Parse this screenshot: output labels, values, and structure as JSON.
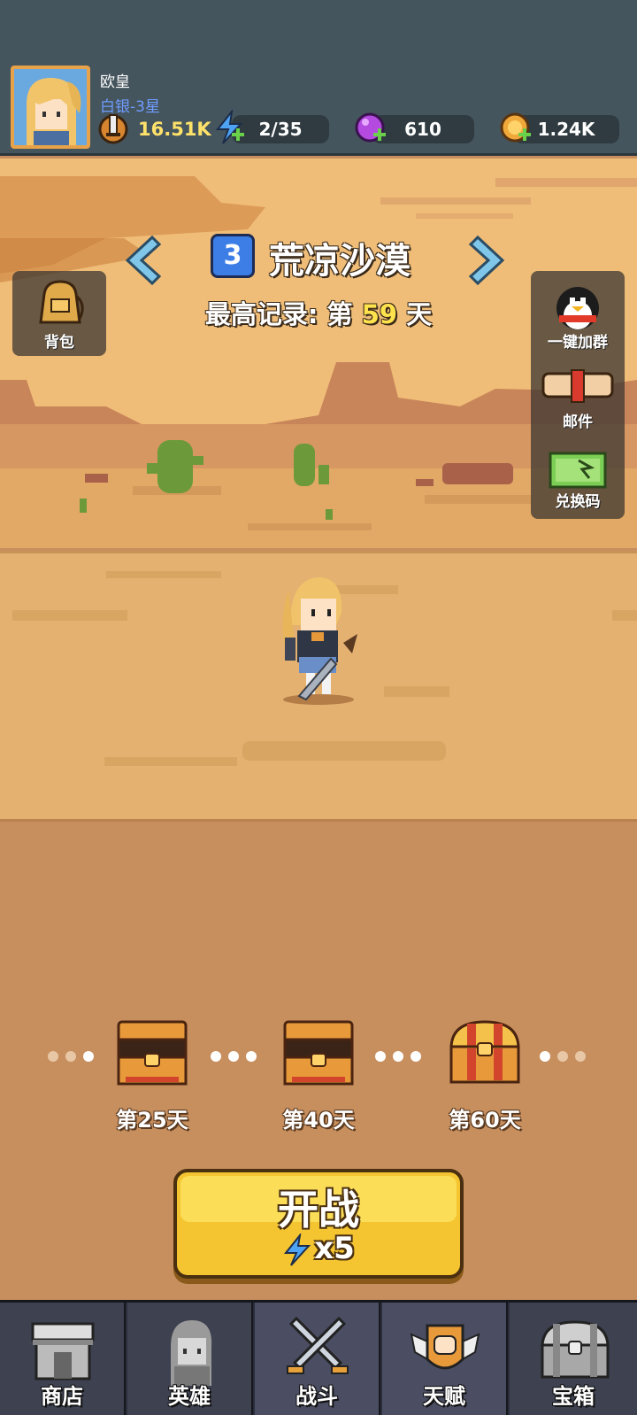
{
  "player": {
    "name": "欧皇",
    "rank": "白银-3星",
    "power": "16.51K"
  },
  "resources": {
    "energy": "2/35",
    "gems": "610",
    "gold": "1.24K"
  },
  "stage": {
    "number": "3",
    "name": "荒凉沙漠",
    "record_prefix": "最高记录: 第",
    "record_day": "59",
    "record_suffix": "天"
  },
  "side_buttons": {
    "backpack": "背包",
    "join_group": "一键加群",
    "mail": "邮件",
    "redeem": "兑换码"
  },
  "rewards": [
    {
      "label": "第25天"
    },
    {
      "label": "第40天"
    },
    {
      "label": "第60天"
    }
  ],
  "battle": {
    "title": "开战",
    "cost": "x5"
  },
  "nav": [
    {
      "label": "商店"
    },
    {
      "label": "英雄"
    },
    {
      "label": "战斗"
    },
    {
      "label": "天赋"
    },
    {
      "label": "宝箱"
    }
  ],
  "colors": {
    "accent_yellow": "#f5c531",
    "record_day": "#ffe34d",
    "rank_blue": "#6f9cff",
    "topbar": "#45555d"
  }
}
